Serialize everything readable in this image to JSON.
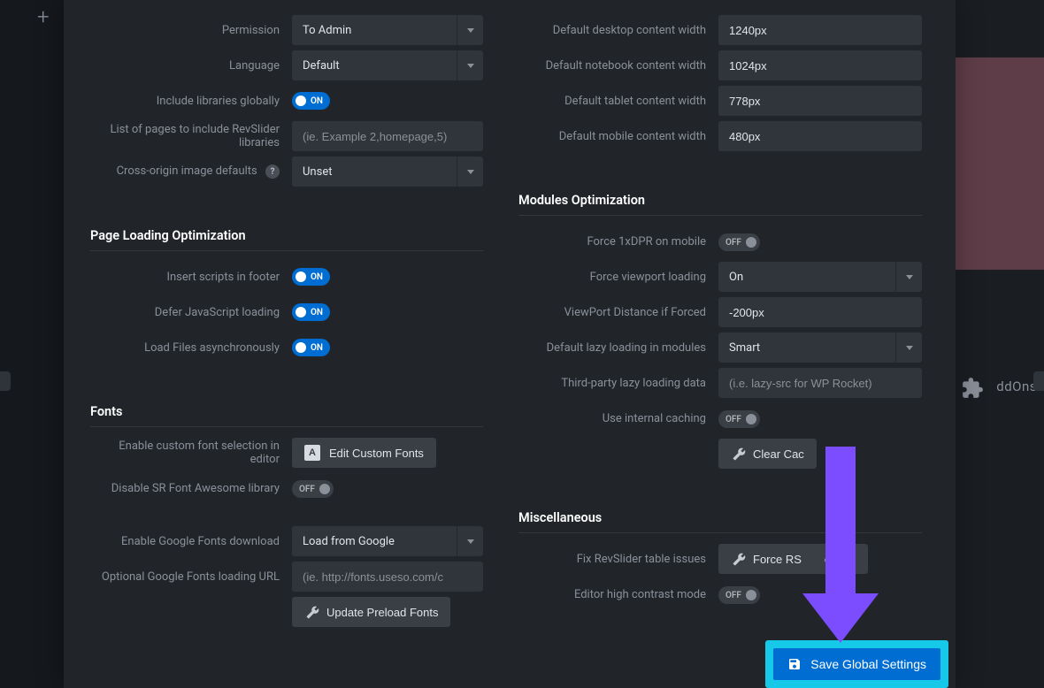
{
  "left_top": {
    "permission_label": "Permission",
    "permission_value": "To Admin",
    "language_label": "Language",
    "language_value": "Default",
    "include_libs_label": "Include libraries globally",
    "include_libs_value": "ON",
    "pages_list_label": "List of pages to include RevSlider libraries",
    "pages_list_placeholder": "(ie. Example 2,homepage,5)",
    "cors_label": "Cross-origin image defaults",
    "cors_value": "Unset"
  },
  "page_loading": {
    "title": "Page Loading Optimization",
    "scripts_footer_label": "Insert scripts in footer",
    "scripts_footer_value": "ON",
    "defer_js_label": "Defer JavaScript loading",
    "defer_js_value": "ON",
    "async_files_label": "Load Files asynchronously",
    "async_files_value": "ON"
  },
  "fonts": {
    "title": "Fonts",
    "custom_font_label": "Enable custom font selection in editor",
    "edit_fonts_btn": "Edit Custom Fonts",
    "disable_fa_label": "Disable SR Font Awesome library",
    "disable_fa_value": "OFF",
    "enable_gfonts_label": "Enable Google Fonts download",
    "enable_gfonts_value": "Load from Google",
    "gfonts_url_label": "Optional Google Fonts loading URL",
    "gfonts_url_placeholder": "(ie. http://fonts.useso.com/c",
    "update_preload_btn": "Update Preload Fonts"
  },
  "widths": {
    "desktop_label": "Default desktop content width",
    "desktop_value": "1240px",
    "notebook_label": "Default notebook content width",
    "notebook_value": "1024px",
    "tablet_label": "Default tablet content width",
    "tablet_value": "778px",
    "mobile_label": "Default mobile content width",
    "mobile_value": "480px"
  },
  "modules_opt": {
    "title": "Modules Optimization",
    "force_1xdpr_label": "Force 1xDPR on mobile",
    "force_1xdpr_value": "OFF",
    "force_viewport_label": "Force viewport loading",
    "force_viewport_value": "On",
    "viewport_dist_label": "ViewPort Distance if Forced",
    "viewport_dist_value": "-200px",
    "lazy_loading_label": "Default lazy loading in modules",
    "lazy_loading_value": "Smart",
    "third_party_lazy_label": "Third-party lazy loading data",
    "third_party_lazy_placeholder": "(i.e. lazy-src for WP Rocket)",
    "internal_cache_label": "Use internal caching",
    "internal_cache_value": "OFF",
    "clear_cache_btn": "Clear Cac"
  },
  "misc": {
    "title": "Miscellaneous",
    "fix_table_label": "Fix RevSlider table issues",
    "force_rs_btn_pre": "Force RS",
    "force_rs_btn_post": "eation",
    "high_contrast_label": "Editor high contrast mode",
    "high_contrast_value": "OFF"
  },
  "save_btn": "Save Global Settings",
  "bg_addons": "ddOns"
}
